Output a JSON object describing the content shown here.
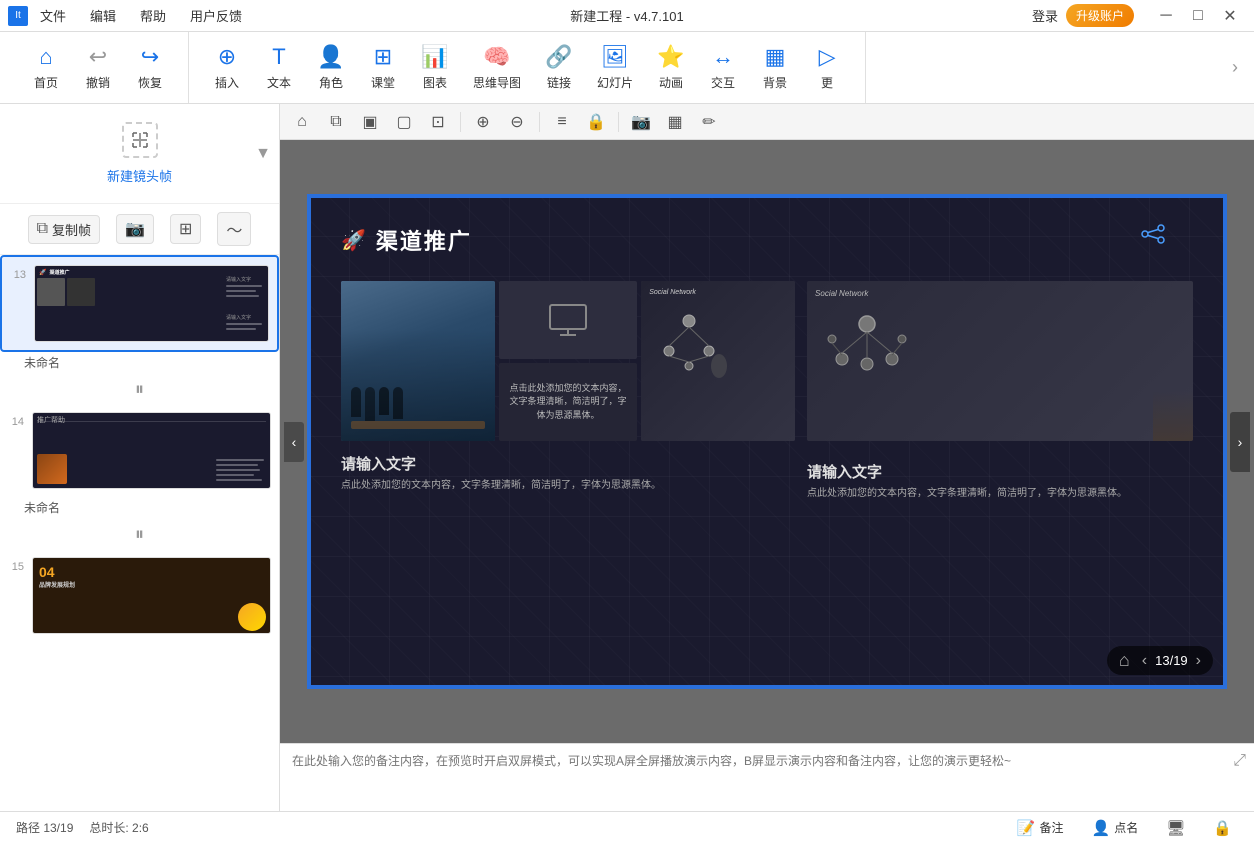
{
  "titlebar": {
    "appname": "It",
    "menus": [
      "文件",
      "编辑",
      "帮助",
      "用户反馈"
    ],
    "title": "新建工程 - v4.7.101",
    "login": "登录",
    "upgrade": "升级账户",
    "minimize": "─",
    "maximize": "□",
    "close": "✕"
  },
  "toolbar": {
    "home": "首页",
    "undo": "撤销",
    "redo": "恢复",
    "insert": "插入",
    "text": "文本",
    "character": "角色",
    "classroom": "课堂",
    "chart": "图表",
    "mindmap": "思维导图",
    "link": "链接",
    "slideshow": "幻灯片",
    "animation": "动画",
    "interact": "交互",
    "background": "背景",
    "more": "更"
  },
  "sidebar": {
    "new_frame": "新建镜头帧",
    "copy_frame": "复制帧",
    "slides": [
      {
        "number": "13",
        "name": "未命名",
        "active": true
      },
      {
        "number": "14",
        "name": "未命名",
        "active": false
      },
      {
        "number": "15",
        "name": "",
        "active": false
      }
    ]
  },
  "canvas_toolbar": {
    "icons": [
      "⌂",
      "⧉",
      "▣",
      "▢",
      "⊕",
      "⊖",
      "≡",
      "🔒",
      "📷",
      "▦",
      "✏"
    ]
  },
  "slide": {
    "title": "渠道推广",
    "left_section": {
      "input_title": "请输入文字",
      "input_body": "点此处添加您的文本内容，文字条理清晰，简洁明了，字体为思源黑体。"
    },
    "right_section": {
      "input_title": "请输入文字",
      "input_body": "点此处添加您的文本内容，文字条理清晰，简洁明了，字体为思源黑体。"
    },
    "text_panel": "点击此处添加您的文本内容，文字条理清晰，简洁明了，字体为思源黑体。",
    "page": "13/19"
  },
  "notes": {
    "placeholder": "在此处输入您的备注内容，在预览时开启双屏模式，可以实现A屏全屏播放演示内容，B屏显示演示内容和备注内容，让您的演示更轻松~"
  },
  "statusbar": {
    "path": "路径 13/19",
    "total": "总时长: 2:6",
    "note": "备注",
    "attendance": "点名",
    "screen": "",
    "lock": ""
  }
}
